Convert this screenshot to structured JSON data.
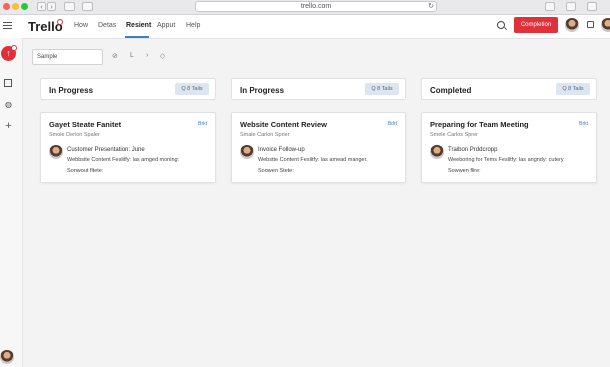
{
  "browser": {
    "url": "trello.com",
    "back_label": "‹",
    "forward_label": "›",
    "dot_colors": [
      "#ff5f57",
      "#febc2e",
      "#28c840"
    ]
  },
  "app": {
    "logo": "Trello",
    "nav": [
      "How",
      "Detas",
      "Resient",
      "Apput",
      "Help"
    ],
    "active_nav": "Resient",
    "cta_label": "Completion",
    "brand_color": "#e0313b",
    "accent_color": "#3b82c4"
  },
  "sidebar": {
    "fab_label": "↑",
    "icons": [
      "board-icon",
      "palette-icon",
      "plus-icon"
    ]
  },
  "toolbar": {
    "search_value": "Sample",
    "icons": [
      "⊘",
      "L",
      "›",
      "◇"
    ]
  },
  "columns": [
    {
      "title": "In Progress",
      "tasks_label": "Q 8 Tails",
      "card": {
        "title": "Gayet Steate Fanitet",
        "subtitle": "Smole Derion Spaler",
        "edit": "Brkt",
        "line1": "Customer Presentation: June",
        "line2": "Webbsite Content Feslitfy: las amged moning:",
        "line3": "Sonwout fltete:"
      }
    },
    {
      "title": "In Progress",
      "tasks_label": "Q 8 Tails",
      "card": {
        "title": "Website Content Review",
        "subtitle": "Smale Carlon Sprier",
        "edit": "Bdrt",
        "line1": "Invoice Follow-up",
        "line2": "Webstte Content Feslitfy: las amead manger.",
        "line3": "Soowen Stete:"
      }
    },
    {
      "title": "Completed",
      "tasks_label": "Q 8 Tails",
      "card": {
        "title": "Preparing for Team Meeting",
        "subtitle": "Smele Carlos Sprer",
        "edit": "Brkt",
        "line1": "Traibon Prddcropp",
        "line2": "Weeboring for Tems Feslitfy: las angndy: cutery",
        "line3": "Sowwen flire:"
      }
    }
  ]
}
